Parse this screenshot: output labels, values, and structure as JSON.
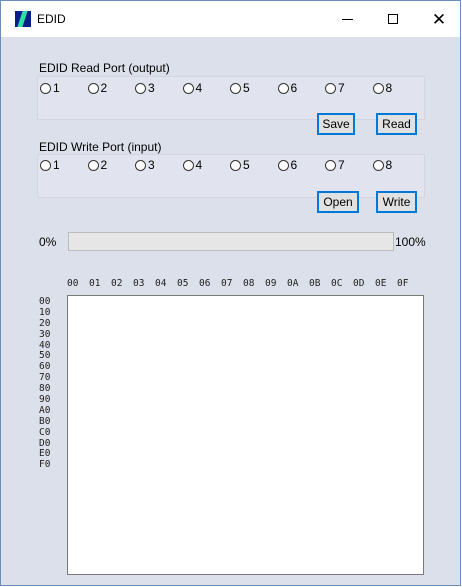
{
  "window": {
    "title": "EDID",
    "icon": "app-icon",
    "controls": [
      "minimize-icon",
      "maximize-icon",
      "close-icon"
    ],
    "close_glyph": "✕"
  },
  "read_port": {
    "label": "EDID Read Port (output)",
    "options": [
      "1",
      "2",
      "3",
      "4",
      "5",
      "6",
      "7",
      "8"
    ]
  },
  "write_port": {
    "label": "EDID Write Port (input)",
    "options": [
      "1",
      "2",
      "3",
      "4",
      "5",
      "6",
      "7",
      "8"
    ]
  },
  "buttons": {
    "save": "Save",
    "read": "Read",
    "open": "Open",
    "write": "Write"
  },
  "progress": {
    "min_label": "0%",
    "max_label": "100%",
    "value": 0
  },
  "hex_table": {
    "columns": [
      "00",
      "01",
      "02",
      "03",
      "04",
      "05",
      "06",
      "07",
      "08",
      "09",
      "0A",
      "0B",
      "0C",
      "0D",
      "0E",
      "0F"
    ],
    "rows": [
      "00",
      "10",
      "20",
      "30",
      "40",
      "50",
      "60",
      "70",
      "80",
      "90",
      "A0",
      "B0",
      "C0",
      "D0",
      "E0",
      "F0"
    ],
    "content": ""
  },
  "colors": {
    "accent": "#0078d7",
    "panel_bg": "#dce0eb",
    "icon_bg": "#0a1e8c"
  }
}
